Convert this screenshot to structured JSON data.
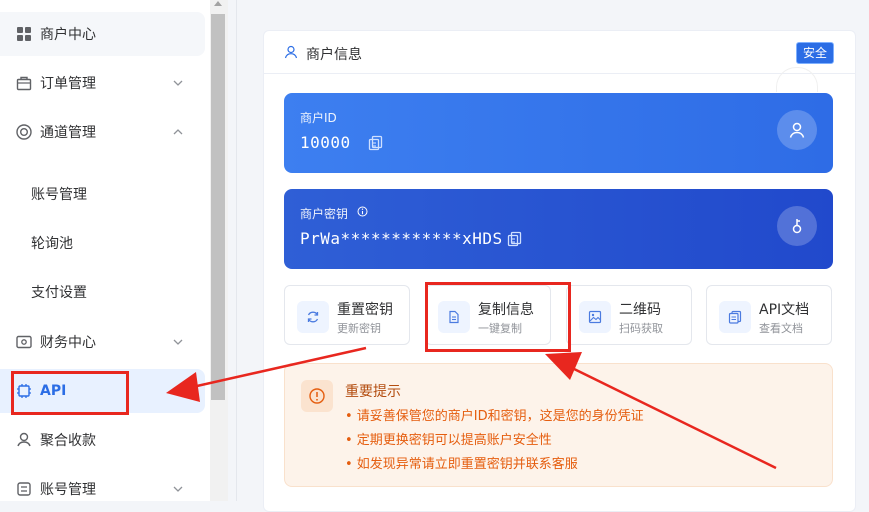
{
  "sidebar": {
    "items": [
      {
        "label": "商户中心",
        "icon": "grid-icon"
      },
      {
        "label": "订单管理",
        "icon": "bag-icon"
      },
      {
        "label": "通道管理",
        "icon": "lifebuoy-icon"
      },
      {
        "label": "账号管理",
        "icon": ""
      },
      {
        "label": "轮询池",
        "icon": ""
      },
      {
        "label": "支付设置",
        "icon": ""
      },
      {
        "label": "财务中心",
        "icon": "finance-icon"
      },
      {
        "label": "API",
        "icon": "chip-icon"
      },
      {
        "label": "聚合收款",
        "icon": "aggregate-icon"
      },
      {
        "label": "账号管理",
        "icon": "account-icon"
      }
    ]
  },
  "card": {
    "title": "商户信息",
    "badge": "安全",
    "merchant_id": {
      "label": "商户ID",
      "value": "10000"
    },
    "merchant_key": {
      "label": "商户密钥",
      "value": "PrWa************xHDS"
    },
    "actions": [
      {
        "title": "重置密钥",
        "subtitle": "更新密钥",
        "icon": "refresh-icon"
      },
      {
        "title": "复制信息",
        "subtitle": "一键复制",
        "icon": "document-icon"
      },
      {
        "title": "二维码",
        "subtitle": "扫码获取",
        "icon": "image-icon"
      },
      {
        "title": "API文档",
        "subtitle": "查看文档",
        "icon": "copy-doc-icon"
      }
    ],
    "notice": {
      "title": "重要提示",
      "lines": [
        "• 请妥善保管您的商户ID和密钥，这是您的身份凭证",
        "• 定期更换密钥可以提高账户安全性",
        "• 如发现异常请立即重置密钥并联系客服"
      ]
    }
  },
  "colors": {
    "accent": "#2b6de5",
    "highlight": "#e8271f",
    "notice": "#e55d0e"
  }
}
